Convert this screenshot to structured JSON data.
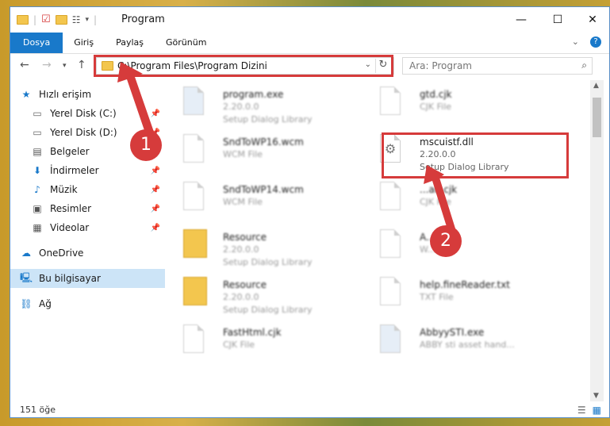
{
  "window": {
    "title": "Program",
    "minimize": "—",
    "maximize": "☐",
    "close": "✕"
  },
  "ribbon": {
    "tabs": [
      "Dosya",
      "Giriş",
      "Paylaş",
      "Görünüm"
    ],
    "help": "?"
  },
  "nav": {
    "address_path": "C:\\Program Files\\Program Dizini",
    "search_placeholder": "Ara: Program"
  },
  "sidebar": {
    "quick_access": "Hızlı erişim",
    "items": [
      {
        "label": "Yerel Disk (C:)",
        "icon": "drive-icon"
      },
      {
        "label": "Yerel Disk (D:)",
        "icon": "drive-icon"
      },
      {
        "label": "Belgeler",
        "icon": "documents-icon"
      },
      {
        "label": "İndirmeler",
        "icon": "download-icon"
      },
      {
        "label": "Müzik",
        "icon": "music-icon"
      },
      {
        "label": "Resimler",
        "icon": "pictures-icon"
      },
      {
        "label": "Videolar",
        "icon": "video-icon"
      }
    ],
    "onedrive": "OneDrive",
    "this_pc": "Bu bilgisayar",
    "network": "Ağ"
  },
  "files": {
    "left": [
      {
        "name": "program.exe",
        "line2": "2.20.0.0",
        "line3": "Setup Dialog Library",
        "kind": "exe"
      },
      {
        "name": "SndToWP16.wcm",
        "line2": "WCM File",
        "line3": "",
        "kind": "page"
      },
      {
        "name": "SndToWP14.wcm",
        "line2": "WCM File",
        "line3": "",
        "kind": "page"
      },
      {
        "name": "Resource",
        "line2": "2.20.0.0",
        "line3": "Setup Dialog Library",
        "kind": "folder"
      },
      {
        "name": "Resource",
        "line2": "2.20.0.0",
        "line3": "Setup Dialog Library",
        "kind": "folder"
      },
      {
        "name": "FastHtml.cjk",
        "line2": "CJK File",
        "line3": "",
        "kind": "page"
      }
    ],
    "right": [
      {
        "name": "gtd.cjk",
        "line2": "CJK File",
        "line3": "",
        "kind": "page"
      },
      {
        "name": "mscuistf.dll",
        "line2": "2.20.0.0",
        "line3": "Setup Dialog Library",
        "kind": "dll"
      },
      {
        "name": "...an.cjk",
        "line2": "CJK File",
        "line3": "",
        "kind": "page"
      },
      {
        "name": "A...d",
        "line2": "W...",
        "line3": "",
        "kind": "page"
      },
      {
        "name": "help.fineReader.txt",
        "line2": "TXT File",
        "line3": "",
        "kind": "page"
      },
      {
        "name": "AbbyySTI.exe",
        "line2": "ABBY sti asset hand...",
        "line3": "",
        "kind": "exe"
      }
    ]
  },
  "status": {
    "count": "151 öğe"
  },
  "callouts": [
    "1",
    "2"
  ],
  "colors": {
    "accent": "#1979ca",
    "highlight": "#d63b3b"
  }
}
